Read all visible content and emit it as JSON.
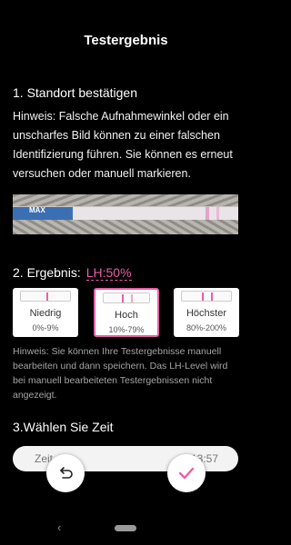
{
  "header": {
    "title": "Testergebnis"
  },
  "section1": {
    "heading": "1. Standort bestätigen",
    "hint": "Hinweis: Falsche Aufnahmewinkel oder ein unscharfes Bild können zu einer falschen Identifizierung führen. Sie können es erneut versuchen oder manuell markieren.",
    "strip_brand": "MAX"
  },
  "section2": {
    "heading": "2. Ergebnis:",
    "result": "LH:50%",
    "options": [
      {
        "label": "Niedrig",
        "range": "0%-9%",
        "selected": false
      },
      {
        "label": "Hoch",
        "range": "10%-79%",
        "selected": true
      },
      {
        "label": "Höchster",
        "range": "80%-200%",
        "selected": false
      }
    ],
    "hint": "Hinweis: Sie können Ihre Testergebnisse manuell bearbeiten und dann speichern. Das LH-Level wird bei manuell bearbeiteten Testergebnissen nicht angezeigt."
  },
  "section3": {
    "heading": "3.Wählen Sie Zeit",
    "field_label": "Zeit",
    "field_value": "13:57"
  },
  "colors": {
    "accent": "#e95fa8",
    "background": "#000000"
  },
  "icons": {
    "undo": "undo-icon",
    "confirm": "checkmark-icon",
    "back": "nav-back-icon"
  }
}
